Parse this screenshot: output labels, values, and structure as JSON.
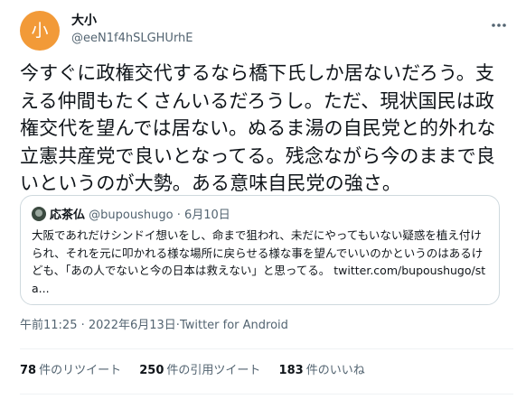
{
  "author": {
    "avatar_char": "小",
    "avatar_color": "#f29a38",
    "display_name": "大小",
    "handle": "@eeN1f4hSLGHUrhE"
  },
  "menu": {
    "icon": "more-horizontal-icon"
  },
  "tweet": {
    "text": "今すぐに政権交代するなら橋下氏しか居ないだろう。支える仲間もたくさんいるだろうし。ただ、現状国民は政権交代を望んでは居ない。ぬるま湯の自民党と的外れな立憲共産党で良いとなってる。残念ながら今のままで良いというのが大勢。ある意味自民党の強さ。"
  },
  "quoted": {
    "display_name": "応茶仏",
    "handle": "@bupoushugo",
    "separator": "·",
    "date": "6月10日",
    "text": "大阪であれだけシンドイ想いをし、命まで狙われ、未だにやってもいない疑惑を植え付けられ、それを元に叩かれる様な場所に戻らせる様な事を望んでいいのかというのはあるけども、「あの人でないと今の日本は救えない」と思ってる。",
    "link": "twitter.com/bupoushugo/sta..."
  },
  "meta": {
    "time": "午前11:25",
    "sep1": "·",
    "date": "2022年6月13日",
    "sep2": "·",
    "client": "Twitter for Android"
  },
  "stats": {
    "retweets_count": "78",
    "retweets_label": "件のリツイート",
    "quotes_count": "250",
    "quotes_label": "件の引用ツイート",
    "likes_count": "183",
    "likes_label": "件のいいね"
  }
}
